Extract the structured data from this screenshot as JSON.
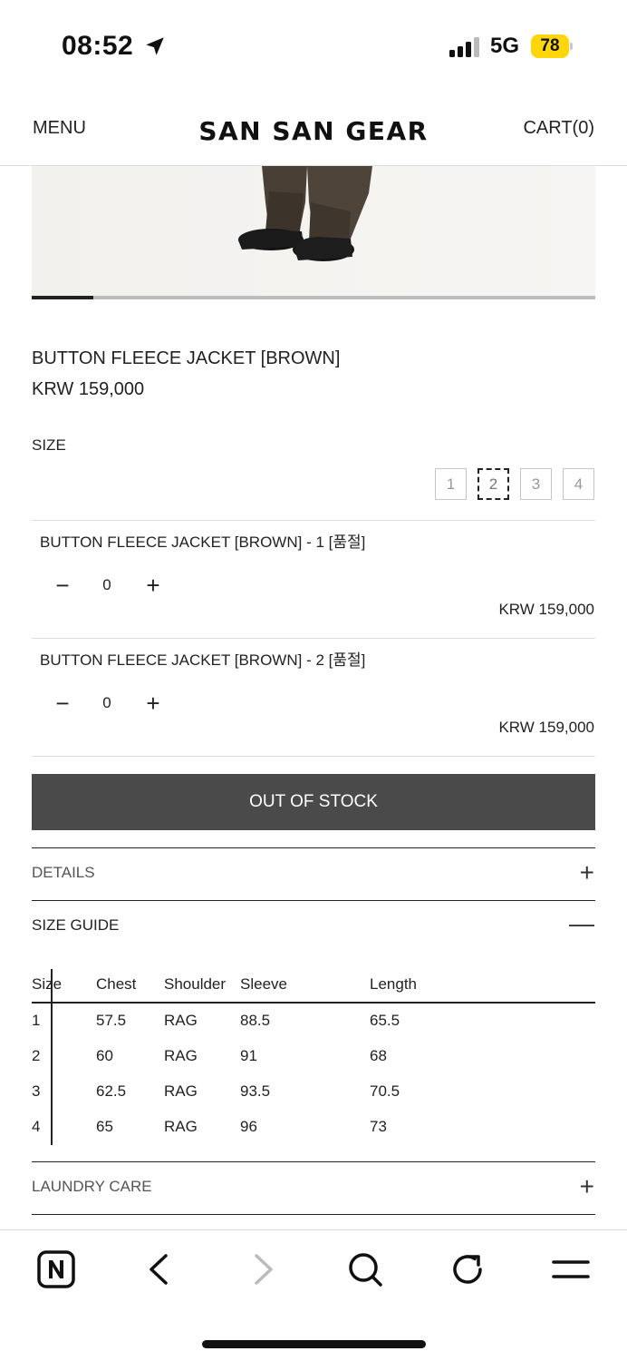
{
  "status_bar": {
    "time": "08:52",
    "network": "5G",
    "battery": "78"
  },
  "header": {
    "menu": "MENU",
    "brand": "SAN SAN GEAR",
    "cart": "CART(0)"
  },
  "gallery": {
    "slide_progress": 0.11
  },
  "product": {
    "name": "BUTTON FLEECE JACKET [BROWN]",
    "price": "KRW 159,000",
    "size_label": "SIZE",
    "sizes": [
      "1",
      "2",
      "3",
      "4"
    ],
    "selected_size": "2"
  },
  "options": [
    {
      "name": "BUTTON FLEECE JACKET [BROWN] - 1 [품절]",
      "minus": "−",
      "qty": "0",
      "plus": "+",
      "price": "KRW 159,000"
    },
    {
      "name": "BUTTON FLEECE JACKET [BROWN] - 2 [품절]",
      "minus": "−",
      "qty": "0",
      "plus": "+",
      "price": "KRW 159,000"
    }
  ],
  "buy_button": "OUT OF STOCK",
  "accordion": {
    "details": {
      "title": "DETAILS",
      "icon": "+"
    },
    "size_guide": {
      "title": "SIZE GUIDE",
      "icon": "—"
    },
    "laundry": {
      "title": "LAUNDRY CARE",
      "icon": "+"
    }
  },
  "size_table": {
    "headers": [
      "Size",
      "Chest",
      "Shoulder",
      "Sleeve",
      "Length"
    ],
    "rows": [
      [
        "1",
        "57.5",
        "RAG",
        "88.5",
        "65.5"
      ],
      [
        "2",
        "60",
        "RAG",
        "91",
        "68"
      ],
      [
        "3",
        "62.5",
        "RAG",
        "93.5",
        "70.5"
      ],
      [
        "4",
        "65",
        "RAG",
        "96",
        "73"
      ]
    ]
  },
  "toolbar": {
    "icons": [
      "naver-icon",
      "back-icon",
      "forward-icon",
      "search-icon",
      "reload-icon",
      "menu-icon"
    ]
  }
}
